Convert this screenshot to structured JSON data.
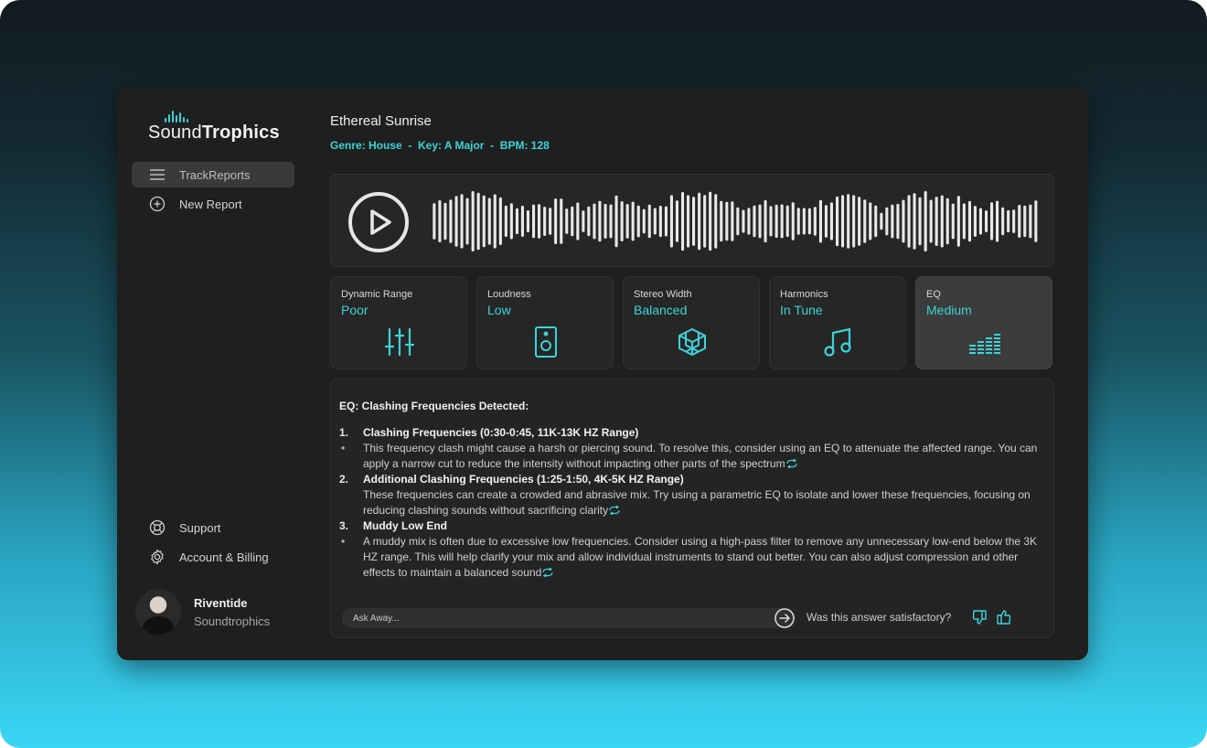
{
  "brand": {
    "name_light": "Sound",
    "name_bold": "Trophics",
    "accent": "#3dd3d8"
  },
  "sidebar": {
    "items": [
      {
        "label": "TrackReports",
        "icon": "menu-icon",
        "active": true
      },
      {
        "label": "New Report",
        "icon": "plus-circle-icon",
        "active": false
      }
    ],
    "bottom_items": [
      {
        "label": "Support",
        "icon": "lifebuoy-icon"
      },
      {
        "label": "Account & Billing",
        "icon": "gear-icon"
      }
    ],
    "user": {
      "name": "Riventide",
      "org": "Soundtrophics"
    }
  },
  "track": {
    "title": "Ethereal Sunrise",
    "meta": "Genre: House  -  Key: A Major  -  BPM: 128"
  },
  "metrics": [
    {
      "label": "Dynamic Range",
      "value": "Poor",
      "icon": "sliders-icon"
    },
    {
      "label": "Loudness",
      "value": "Low",
      "icon": "speaker-icon"
    },
    {
      "label": "Stereo Width",
      "value": "Balanced",
      "icon": "cube-icon"
    },
    {
      "label": "Harmonics",
      "value": "In Tune",
      "icon": "music-note-icon"
    },
    {
      "label": "EQ",
      "value": "Medium",
      "icon": "equalizer-icon",
      "active": true
    }
  ],
  "report": {
    "heading": "EQ: Clashing Frequencies Detected:",
    "items": [
      {
        "num": "1.",
        "title": "Clashing Frequencies (0:30-0:45, 11K-13K HZ Range)",
        "bullet": "•",
        "text": "This frequency clash might cause a harsh or piercing sound. To resolve this, consider using an EQ to attenuate the affected range. You can apply a narrow cut to reduce the intensity without impacting other parts of the spectrum"
      },
      {
        "num": "2.",
        "title": "Additional Clashing Frequencies (1:25-1:50, 4K-5K HZ Range)",
        "bullet": "",
        "text": "These frequencies can create a crowded and abrasive mix. Try using a parametric EQ to isolate and lower these frequencies, focusing on reducing clashing sounds without sacrificing clarity"
      },
      {
        "num": "3.",
        "title": "Muddy Low End",
        "bullet": "•",
        "text": "A muddy mix is often due to excessive low frequencies. Consider using a high-pass filter to remove any unnecessary low-end below the 3K HZ range. This will help clarify your mix and allow individual instruments to stand out better. You can also adjust compression and other effects to maintain a balanced sound"
      }
    ],
    "ask_placeholder": "Ask Away...",
    "feedback_question": "Was this answer satisfactory?"
  }
}
